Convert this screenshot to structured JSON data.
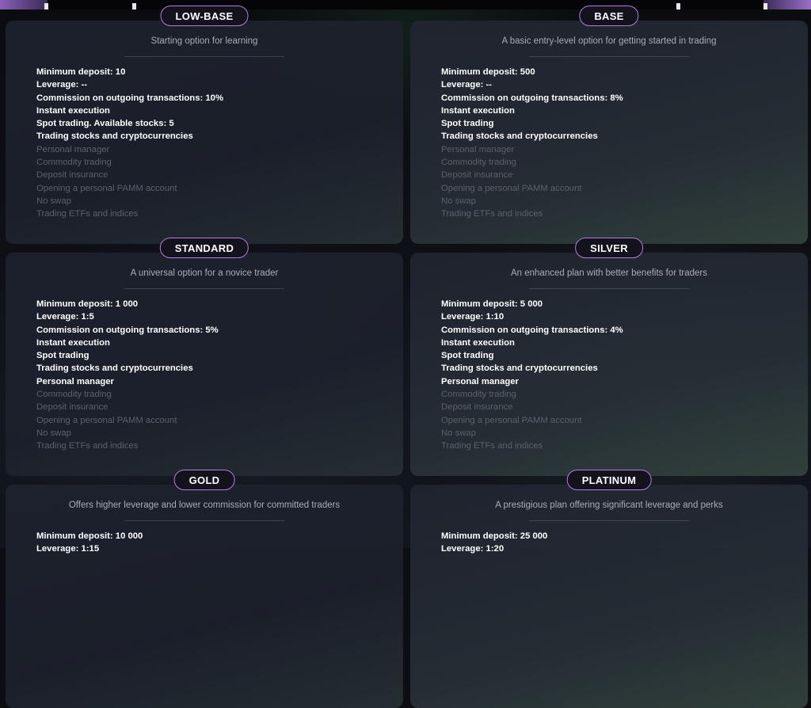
{
  "plans": [
    {
      "id": "low-base",
      "name": "LOW-BASE",
      "subtitle": "Starting option for learning",
      "features": [
        {
          "label": "Minimum deposit: 10",
          "enabled": true
        },
        {
          "label": "Leverage: --",
          "enabled": true
        },
        {
          "label": "Commission on outgoing transactions: 10%",
          "enabled": true
        },
        {
          "label": "Instant execution",
          "enabled": true
        },
        {
          "label": "Spot trading. Available stocks: 5",
          "enabled": true
        },
        {
          "label": "Trading stocks and cryptocurrencies",
          "enabled": true
        },
        {
          "label": "Personal manager",
          "enabled": false
        },
        {
          "label": "Commodity trading",
          "enabled": false
        },
        {
          "label": "Deposit insurance",
          "enabled": false
        },
        {
          "label": "Opening a personal PAMM account",
          "enabled": false
        },
        {
          "label": "No swap",
          "enabled": false
        },
        {
          "label": "Trading ETFs and indices",
          "enabled": false
        }
      ]
    },
    {
      "id": "base",
      "name": "BASE",
      "subtitle": "A basic entry-level option for getting started in trading",
      "features": [
        {
          "label": "Minimum deposit: 500",
          "enabled": true
        },
        {
          "label": "Leverage: --",
          "enabled": true
        },
        {
          "label": "Commission on outgoing transactions: 8%",
          "enabled": true
        },
        {
          "label": "Instant execution",
          "enabled": true
        },
        {
          "label": "Spot trading",
          "enabled": true
        },
        {
          "label": "Trading stocks and cryptocurrencies",
          "enabled": true
        },
        {
          "label": "Personal manager",
          "enabled": false
        },
        {
          "label": "Commodity trading",
          "enabled": false
        },
        {
          "label": "Deposit insurance",
          "enabled": false
        },
        {
          "label": "Opening a personal PAMM account",
          "enabled": false
        },
        {
          "label": "No swap",
          "enabled": false
        },
        {
          "label": "Trading ETFs and indices",
          "enabled": false
        }
      ]
    },
    {
      "id": "standard",
      "name": "STANDARD",
      "subtitle": "A universal option for a novice trader",
      "features": [
        {
          "label": "Minimum deposit: 1 000",
          "enabled": true
        },
        {
          "label": "Leverage: 1:5",
          "enabled": true
        },
        {
          "label": "Commission on outgoing transactions: 5%",
          "enabled": true
        },
        {
          "label": "Instant execution",
          "enabled": true
        },
        {
          "label": "Spot trading",
          "enabled": true
        },
        {
          "label": "Trading stocks and cryptocurrencies",
          "enabled": true
        },
        {
          "label": "Personal manager",
          "enabled": true
        },
        {
          "label": "Commodity trading",
          "enabled": false
        },
        {
          "label": "Deposit insurance",
          "enabled": false
        },
        {
          "label": "Opening a personal PAMM account",
          "enabled": false
        },
        {
          "label": "No swap",
          "enabled": false
        },
        {
          "label": "Trading ETFs and indices",
          "enabled": false
        }
      ]
    },
    {
      "id": "silver",
      "name": "SILVER",
      "subtitle": "An enhanced plan with better benefits for traders",
      "features": [
        {
          "label": "Minimum deposit: 5 000",
          "enabled": true
        },
        {
          "label": "Leverage: 1:10",
          "enabled": true
        },
        {
          "label": "Commission on outgoing transactions: 4%",
          "enabled": true
        },
        {
          "label": "Instant execution",
          "enabled": true
        },
        {
          "label": "Spot trading",
          "enabled": true
        },
        {
          "label": "Trading stocks and cryptocurrencies",
          "enabled": true
        },
        {
          "label": "Personal manager",
          "enabled": true
        },
        {
          "label": "Commodity trading",
          "enabled": false
        },
        {
          "label": "Deposit insurance",
          "enabled": false
        },
        {
          "label": "Opening a personal PAMM account",
          "enabled": false
        },
        {
          "label": "No swap",
          "enabled": false
        },
        {
          "label": "Trading ETFs and indices",
          "enabled": false
        }
      ]
    },
    {
      "id": "gold",
      "name": "GOLD",
      "subtitle": "Offers higher leverage and lower commission for committed traders",
      "features": [
        {
          "label": "Minimum deposit: 10 000",
          "enabled": true
        },
        {
          "label": "Leverage: 1:15",
          "enabled": true
        }
      ]
    },
    {
      "id": "platinum",
      "name": "PLATINUM",
      "subtitle": "A prestigious plan offering significant leverage and perks",
      "features": [
        {
          "label": "Minimum deposit: 25 000",
          "enabled": true
        },
        {
          "label": "Leverage: 1:20",
          "enabled": true
        }
      ]
    }
  ],
  "colors": {
    "badge_border": "#b07fe0",
    "enabled_text": "#ffffff",
    "disabled_text": "#5b606b",
    "subtitle_text": "#a8acb6"
  }
}
